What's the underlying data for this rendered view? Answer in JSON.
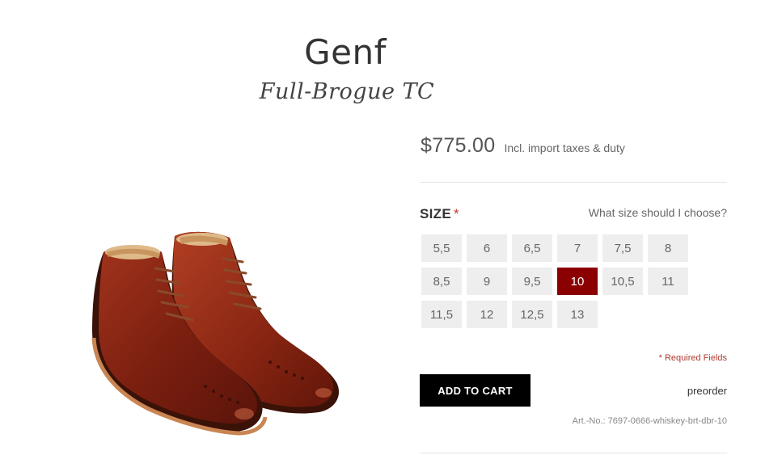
{
  "product": {
    "name": "Genf",
    "model": "Full-Brogue TC",
    "price": "$775.00",
    "price_note": "Incl. import taxes & duty",
    "image_icon": "shoe-pair-icon"
  },
  "size": {
    "label": "SIZE",
    "required_marker": "*",
    "help_link": "What size should I choose?",
    "options": [
      "5,5",
      "6",
      "6,5",
      "7",
      "7,5",
      "8",
      "8,5",
      "9",
      "9,5",
      "10",
      "10,5",
      "11",
      "11,5",
      "12",
      "12,5",
      "13"
    ],
    "selected": "10"
  },
  "form": {
    "required_note": "* Required Fields",
    "add_to_cart": "ADD TO CART",
    "availability": "preorder",
    "article_number": "Art.-No.: 7697-0666-whiskey-brt-dbr-10"
  },
  "colors": {
    "accent": "#8b0000",
    "button": "#000000",
    "size_bg": "#eeeeee"
  }
}
